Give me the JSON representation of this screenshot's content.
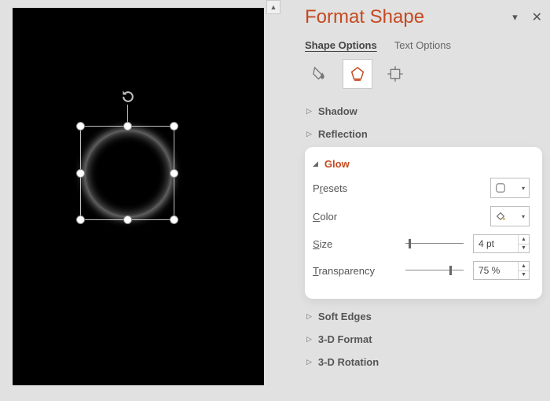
{
  "panel": {
    "title": "Format Shape",
    "tabs": {
      "shape": "Shape Options",
      "text": "Text Options"
    }
  },
  "sections": {
    "shadow": "Shadow",
    "reflection": "Reflection",
    "glow": "Glow",
    "softEdges": "Soft Edges",
    "format3d": "3-D Format",
    "rotation3d": "3-D Rotation"
  },
  "glow": {
    "presetsLabel": "Presets",
    "colorLabel": "Color",
    "sizeLabel": "Size",
    "sizeValue": "4 pt",
    "sizeSliderPct": 5,
    "transparencyLabel": "Transparency",
    "transparencyValue": "75 %",
    "transparencySliderPct": 75
  }
}
